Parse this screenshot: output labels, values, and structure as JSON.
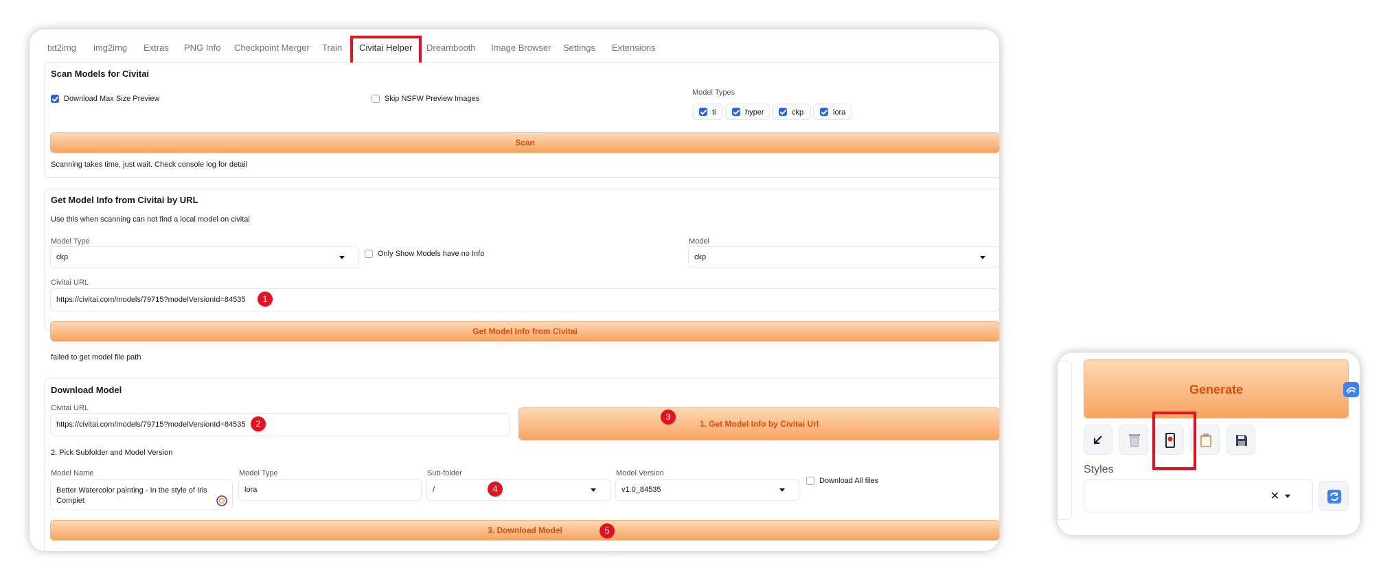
{
  "tabs": [
    "txt2img",
    "img2img",
    "Extras",
    "PNG Info",
    "Checkpoint Merger",
    "Train",
    "Civitai Helper",
    "Dreambooth",
    "Image Browser",
    "Settings",
    "Extensions"
  ],
  "active_tab": "Civitai Helper",
  "scan": {
    "title": "Scan Models for Civitai",
    "download_max_preview": "Download Max Size Preview",
    "skip_nsfw": "Skip NSFW Preview Images",
    "model_types_label": "Model Types",
    "model_types": [
      "ti",
      "hyper",
      "ckp",
      "lora"
    ],
    "button": "Scan",
    "note": "Scanning takes time, just wait. Check console log for detail"
  },
  "get_info": {
    "title": "Get Model Info from Civitai by URL",
    "desc": "Use this when scanning can not find a local model on civitai",
    "model_type_label": "Model Type",
    "model_type_value": "ckp",
    "only_show_label": "Only Show Models have no Info",
    "model_label": "Model",
    "model_value": "ckp",
    "url_label": "Civitai URL",
    "url_value": "https://civitai.com/models/79715?modelVersionId=84535",
    "button": "Get Model Info from Civitai",
    "status": "failed to get model file path"
  },
  "download": {
    "title": "Download Model",
    "url_label": "Civitai URL",
    "url_value": "https://civitai.com/models/79715?modelVersionId=84535",
    "get_info_button": "1. Get Model Info by Civitai Url",
    "pick_label": "2. Pick Subfolder and Model Version",
    "model_name_label": "Model Name",
    "model_name_line1": "Better Watercolor painting - In the style of Iris",
    "model_name_line2": "Compiet",
    "model_type_label": "Model Type",
    "model_type_value": "lora",
    "subfolder_label": "Sub-folder",
    "subfolder_value": "/",
    "version_label": "Model Version",
    "version_value": "v1.0_84535",
    "download_all_label": "Download All files",
    "download_button": "3. Download Model"
  },
  "badges": [
    "1",
    "2",
    "3",
    "4",
    "5"
  ],
  "generate_panel": {
    "generate_label": "Generate",
    "styles_label": "Styles",
    "tool_icons": [
      "arrow-down-left-icon",
      "trash-icon",
      "civitai-helper-icon",
      "clipboard-icon",
      "save-icon"
    ],
    "clear_glyph": "✕"
  },
  "colors": {
    "accent_orange": "#f6a45f",
    "button_text": "#e04a0a",
    "highlight_red": "#e8101e",
    "checkbox_blue": "#2563eb"
  }
}
